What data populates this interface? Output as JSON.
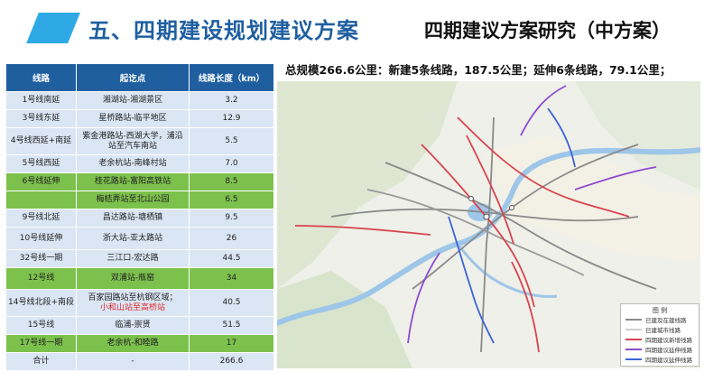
{
  "header": {
    "title": "五、四期建设规划建议方案",
    "subtitle": "四期建议方案研究（中方案）",
    "accent_color": "#2ea9e6"
  },
  "summary": "总规模266.6公里：新建5条线路，187.5公里；延伸6条线路，79.1公里；",
  "table": {
    "headers": [
      "线路",
      "起讫点",
      "线路长度（km）"
    ],
    "rows": [
      {
        "line": "1号线南延",
        "route": "湘湖站-湘湖景区",
        "length": "3.2",
        "style": "blue"
      },
      {
        "line": "3号线东延",
        "route": "星桥路站-临平地区",
        "length": "12.9",
        "style": "blue"
      },
      {
        "line": "4号线西延+南延",
        "route": "紫金港路站-西湖大学，浦沿站至汽车南站",
        "length": "5.5",
        "style": "blue"
      },
      {
        "line": "5号线西延",
        "route": "老余杭站-南峰村站",
        "length": "7.0",
        "style": "blue"
      },
      {
        "line": "6号线延伸",
        "route": "桂花路站-富阳高铁站",
        "length": "8.5",
        "style": "green"
      },
      {
        "line": "",
        "route": "梅桔弄站至北山公园",
        "length": "6.5",
        "style": "green"
      },
      {
        "line": "9号线北延",
        "route": "昌达路站-塘栖镇",
        "length": "9.5",
        "style": "blue"
      },
      {
        "line": "10号线延伸",
        "route": "浙大站-亚太路站",
        "length": "26",
        "style": "blue"
      },
      {
        "line": "32号线一期",
        "route": "三江口-宏达路",
        "length": "44.5",
        "style": "blue"
      },
      {
        "line": "12号线",
        "route": "双浦站-瓶窑",
        "length": "34",
        "style": "green"
      },
      {
        "line": "14号线北段+南段",
        "route": "百家园路站至杭钢区域；",
        "route_red": "小和山站至高桥站",
        "length": "40.5",
        "style": "blue"
      },
      {
        "line": "15号线",
        "route": "临浦-崇贤",
        "length": "51.5",
        "style": "blue"
      },
      {
        "line": "17号线一期",
        "route": "老余杭-和睦路",
        "length": "17",
        "style": "green"
      },
      {
        "line": "合计",
        "route": "-",
        "length": "266.6",
        "style": "total"
      }
    ]
  },
  "map": {
    "legend_title": "图 例",
    "legend_items": [
      {
        "label": "已建及在建线路",
        "color": "#8a8a8a"
      },
      {
        "label": "已建城市线路",
        "color": "#cfcfcf"
      },
      {
        "label": "四期建议新增线路",
        "color": "#d9434e"
      },
      {
        "label": "四期建议延伸线路",
        "color": "#8e4bd0"
      },
      {
        "label": "四期建议延伸线路",
        "color": "#3c63d8"
      }
    ]
  }
}
